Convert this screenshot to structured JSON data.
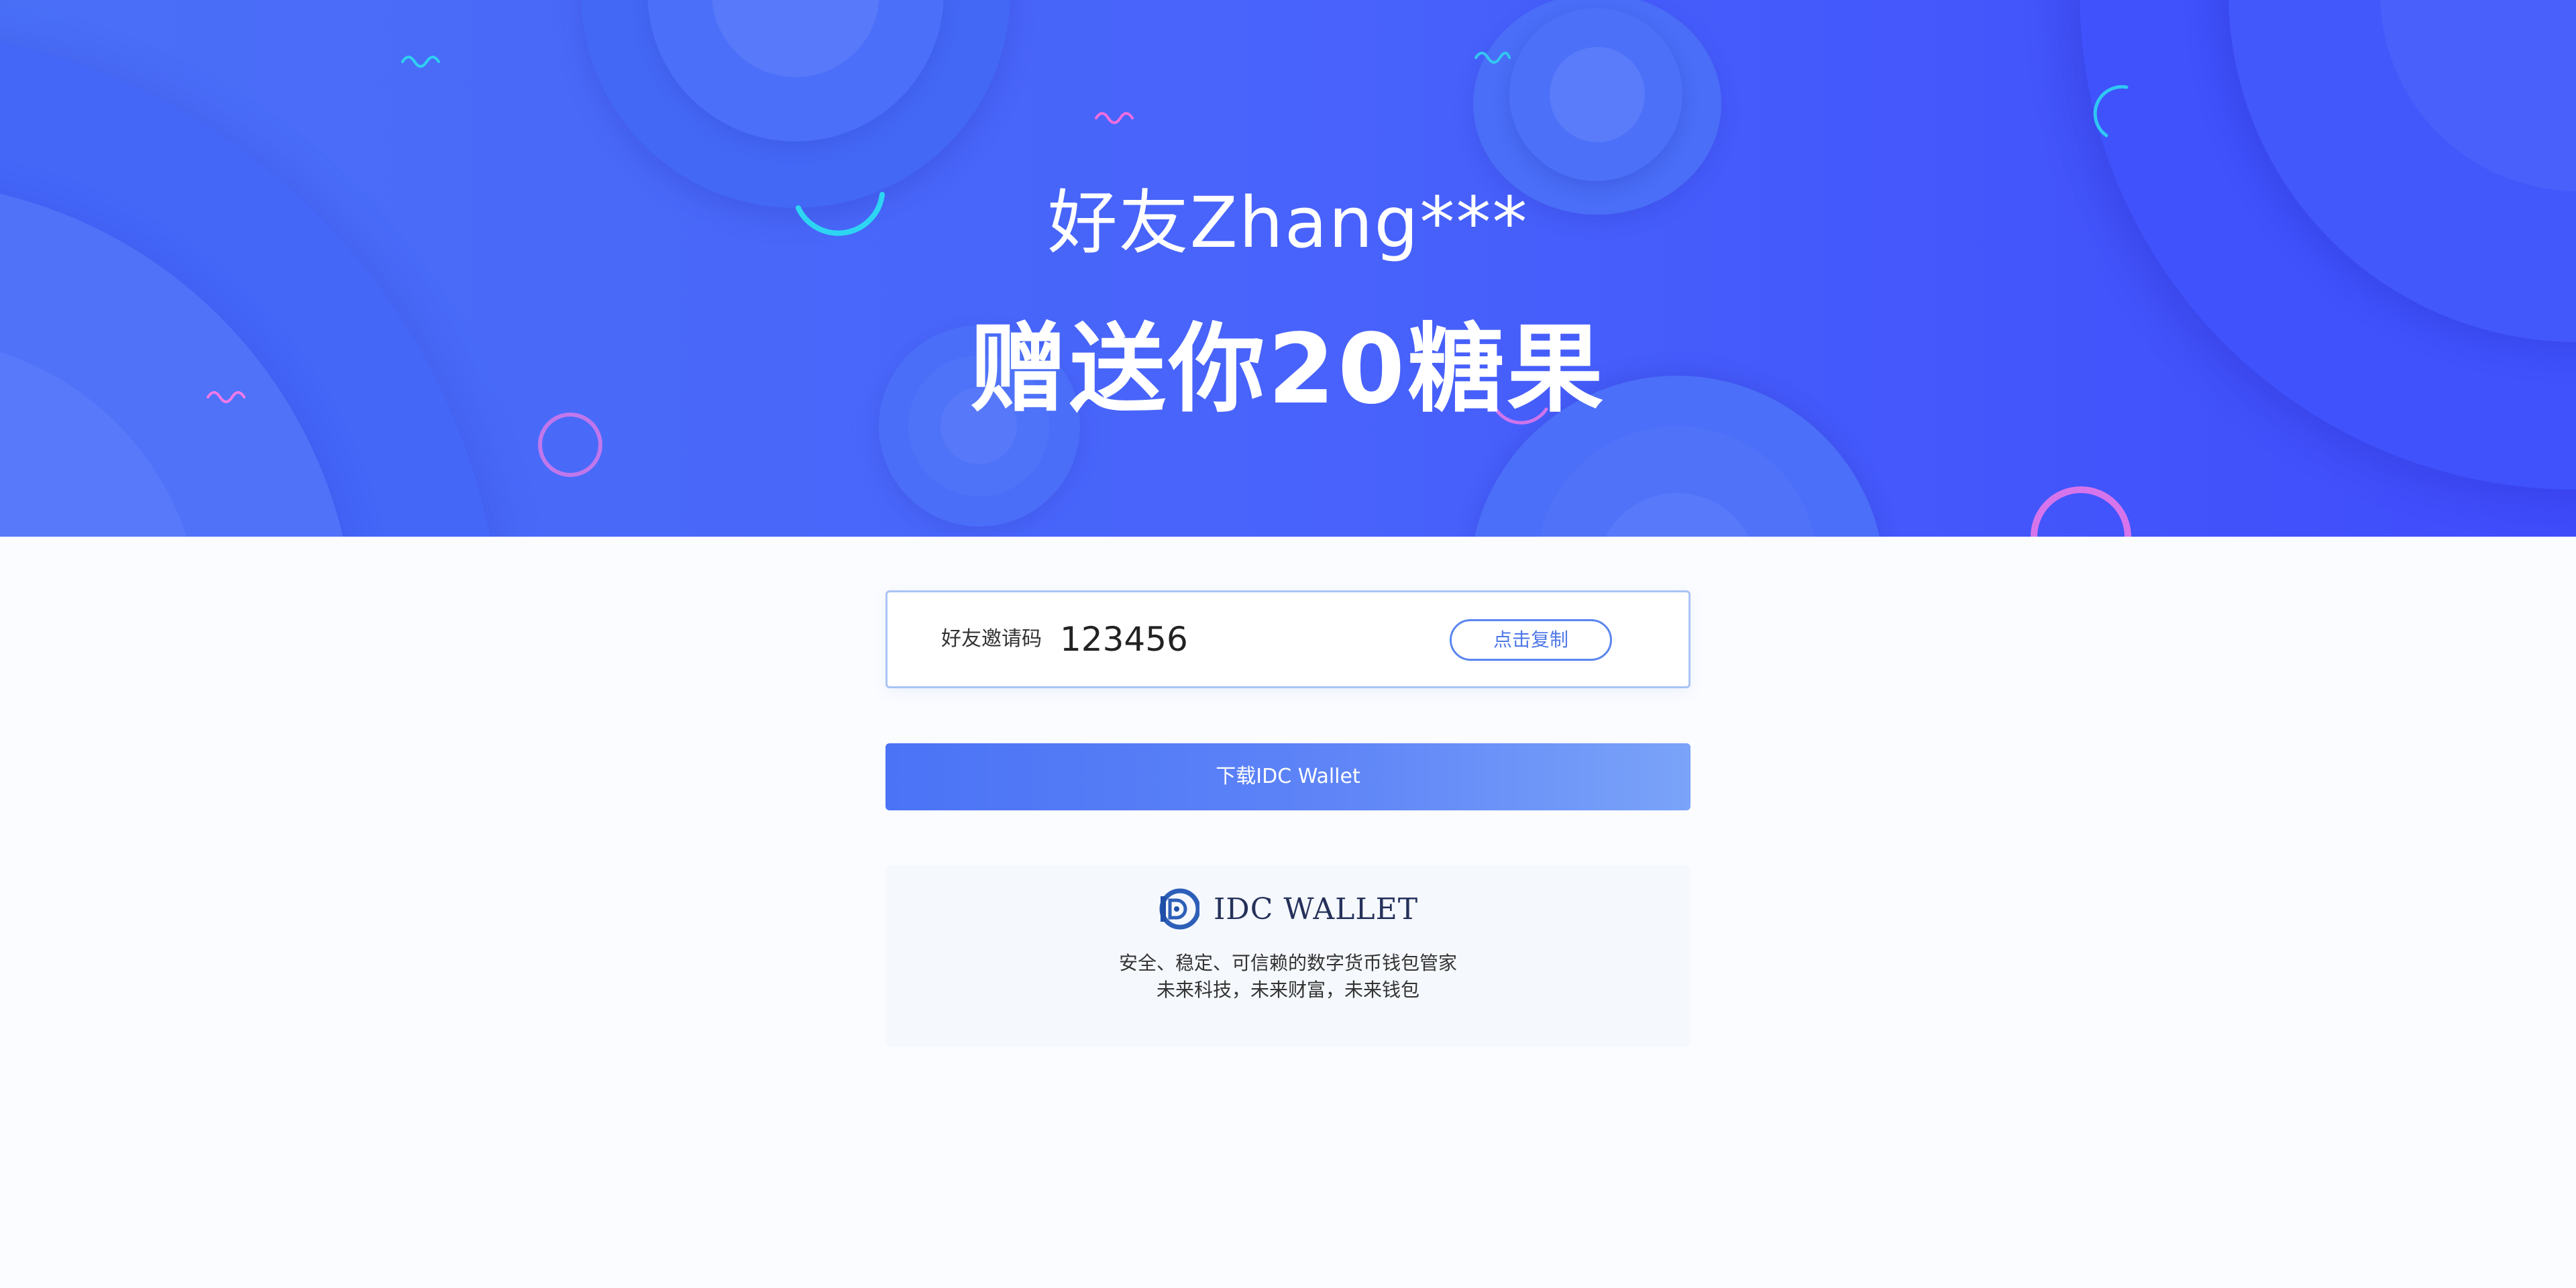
{
  "hero": {
    "friend_line": "好友Zhang***",
    "gift_line": "赠送你20糖果"
  },
  "invite": {
    "label": "好友邀请码",
    "code": "123456",
    "copy_label": "点击复制"
  },
  "download": {
    "label": "下载IDC Wallet"
  },
  "brand": {
    "name": "IDC WALLET",
    "tagline_1": "安全、稳定、可信赖的数字货币钱包管家",
    "tagline_2": "未来科技，未来财富，未来钱包",
    "logo_icon": "idc-wallet-logo-icon"
  },
  "colors": {
    "hero_start": "#4a6ff7",
    "hero_end": "#3f4cfb",
    "accent": "#4f78e8",
    "button_start": "#4a73f6",
    "button_end": "#7aa3f9"
  }
}
